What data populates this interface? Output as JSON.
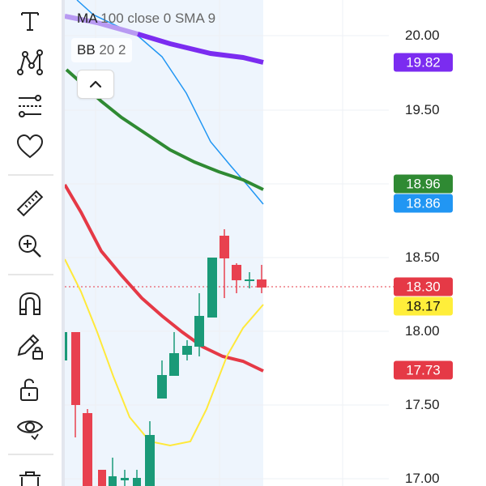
{
  "legend": {
    "ma_name": "MA",
    "ma_params": "100 close 0 SMA 9",
    "bb_name": "BB",
    "bb_params": "20 2"
  },
  "toolbar": {
    "tools": [
      {
        "name": "text-tool-icon"
      },
      {
        "name": "pattern-tool-icon"
      },
      {
        "name": "fib-tool-icon"
      },
      {
        "name": "favorites-heart-icon"
      },
      {
        "name": "ruler-icon"
      },
      {
        "name": "zoom-in-icon"
      },
      {
        "name": "magnet-icon"
      },
      {
        "name": "lock-drawing-icon"
      },
      {
        "name": "unlock-icon"
      },
      {
        "name": "eye-visibility-icon"
      },
      {
        "name": "trash-icon"
      }
    ]
  },
  "price_axis": {
    "ticks": [
      "20.00",
      "19.50",
      "18.50",
      "18.00",
      "17.50",
      "17.00"
    ]
  },
  "price_badges": [
    {
      "label": "19.82",
      "bg": "#7b2cf0",
      "fg": "#ffffff"
    },
    {
      "label": "18.96",
      "bg": "#2f8a33",
      "fg": "#ffffff"
    },
    {
      "label": "18.86",
      "bg": "#2196f3",
      "fg": "#ffffff"
    },
    {
      "label": "18.30",
      "bg": "#e53946",
      "fg": "#ffffff"
    },
    {
      "label": "18.17",
      "bg": "#ffee3a",
      "fg": "#111111"
    },
    {
      "label": "17.73",
      "bg": "#e53946",
      "fg": "#ffffff"
    }
  ],
  "colors": {
    "up": "#1a9a78",
    "down": "#e8414f",
    "ma": "#7b2cf0",
    "bb_basis": "#e53946",
    "bb_upper": "#2f8a33",
    "bb_lower": "#ffee3a",
    "extra_line": "#2196f3",
    "band_fill": "#eef5fd"
  }
}
